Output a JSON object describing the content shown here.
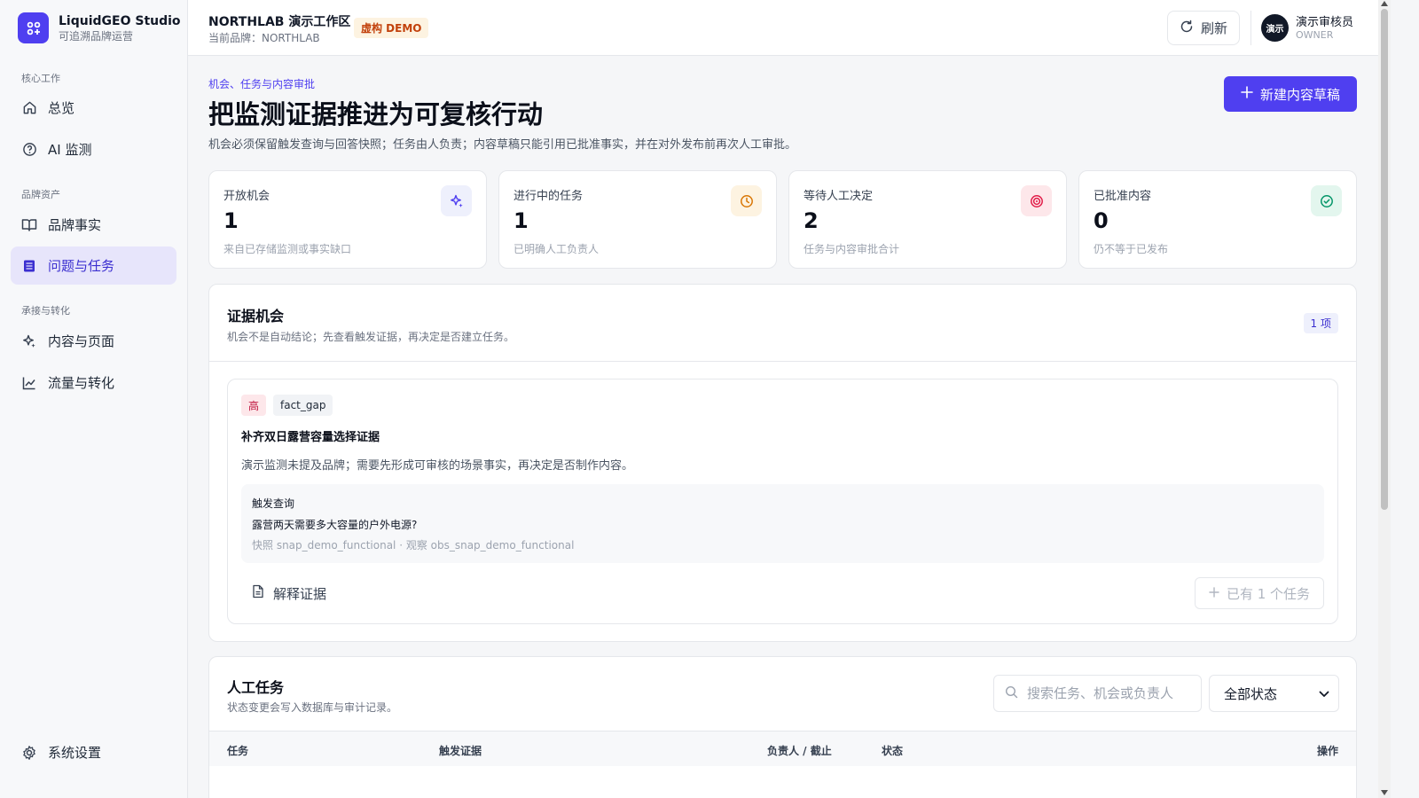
{
  "app": {
    "name": "LiquidGEO Studio",
    "subtitle": "可追溯品牌运营"
  },
  "sidebar": {
    "groups": [
      {
        "label": "核心工作"
      },
      {
        "label": "品牌资产"
      },
      {
        "label": "承接与转化"
      }
    ],
    "items": [
      {
        "label": "总览",
        "icon": "home-icon"
      },
      {
        "label": "AI 监测",
        "icon": "help-circle-icon"
      },
      {
        "label": "品牌事实",
        "icon": "book-open-icon"
      },
      {
        "label": "问题与任务",
        "icon": "list-icon",
        "active": true
      },
      {
        "label": "内容与页面",
        "icon": "sparkle-icon"
      },
      {
        "label": "流量与转化",
        "icon": "trend-chart-icon"
      }
    ],
    "settings_label": "系统设置"
  },
  "header": {
    "workspace": "NORTHLAB 演示工作区",
    "current_brand": "当前品牌：NORTHLAB",
    "demo_badge": "虚构 DEMO",
    "refresh_label": "刷新",
    "user": {
      "avatar": "演示",
      "name": "演示审核员",
      "role": "OWNER"
    }
  },
  "page": {
    "breadcrumb": "机会、任务与内容审批",
    "title": "把监测证据推进为可复核行动",
    "description": "机会必须保留触发查询与回答快照；任务由人负责；内容草稿只能引用已批准事实，并在对外发布前再次人工审批。",
    "new_draft_label": "新建内容草稿"
  },
  "stats": [
    {
      "label": "开放机会",
      "value": "1",
      "hint": "来自已存储监测或事实缺口",
      "icon": "sparkle-icon",
      "color": "#4f3ff0",
      "bg": "#eef0fc"
    },
    {
      "label": "进行中的任务",
      "value": "1",
      "hint": "已明确人工负责人",
      "icon": "clock-icon",
      "color": "#d97706",
      "bg": "#fdf3e1"
    },
    {
      "label": "等待人工决定",
      "value": "2",
      "hint": "任务与内容审批合计",
      "icon": "target-icon",
      "color": "#e11d48",
      "bg": "#fde7ea"
    },
    {
      "label": "已批准内容",
      "value": "0",
      "hint": "仍不等于已发布",
      "icon": "check-circle-icon",
      "color": "#059669",
      "bg": "#e3f6ee"
    }
  ],
  "opportunities": {
    "title": "证据机会",
    "subtitle": "机会不是自动结论；先查看触发证据，再决定是否建立任务。",
    "count_badge": "1 项",
    "items": [
      {
        "priority": "高",
        "type": "fact_gap",
        "title": "补齐双日露营容量选择证据",
        "description": "演示监测未提及品牌；需要先形成可审核的场景事实，再决定是否制作内容。",
        "trigger_label": "触发查询",
        "trigger_query": "露营两天需要多大容量的户外电源?",
        "snapshot": "快照 snap_demo_functional · 观察 obs_snap_demo_functional",
        "explain_label": "解释证据",
        "task_label": "已有 1 个任务"
      }
    ]
  },
  "tasks": {
    "title": "人工任务",
    "subtitle": "状态变更会写入数据库与审计记录。",
    "search_placeholder": "搜索任务、机会或负责人",
    "status_filter": "全部状态",
    "columns": [
      "任务",
      "触发证据",
      "负责人 / 截止",
      "状态",
      "操作"
    ]
  }
}
